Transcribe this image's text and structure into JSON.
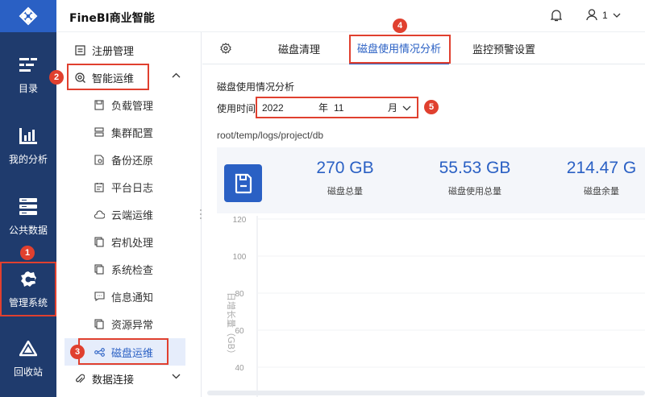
{
  "app": {
    "title": "FineBI商业智能"
  },
  "header": {
    "user_label": "1"
  },
  "rail": {
    "items": [
      {
        "label": "目录",
        "icon": "catalog-icon"
      },
      {
        "label": "我的分析",
        "icon": "analysis-icon"
      },
      {
        "label": "公共数据",
        "icon": "database-icon"
      },
      {
        "label": "管理系统",
        "icon": "settings-icon"
      },
      {
        "label": "回收站",
        "icon": "recycle-icon"
      }
    ]
  },
  "menu": {
    "register": "注册管理",
    "smart_ops": "智能运维",
    "sub_items": [
      "负载管理",
      "集群配置",
      "备份还原",
      "平台日志",
      "云端运维",
      "宕机处理",
      "系统检查",
      "信息通知",
      "资源异常",
      "磁盘运维"
    ],
    "data_conn": "数据连接"
  },
  "tabs": [
    "磁盘清理",
    "磁盘使用情况分析",
    "监控预警设置"
  ],
  "panel": {
    "title": "磁盘使用情况分析",
    "time_label": "使用时间",
    "year": "2022",
    "year_unit": "年",
    "month": "11",
    "month_unit": "月",
    "path": "root/temp/logs/project/db"
  },
  "stats": [
    {
      "value": "270 GB",
      "label": "磁盘总量"
    },
    {
      "value": "55.53 GB",
      "label": "磁盘使用总量"
    },
    {
      "value": "214.47 G",
      "label": "磁盘余量"
    }
  ],
  "badges": [
    "1",
    "2",
    "3",
    "4",
    "5"
  ],
  "chart_data": {
    "type": "line",
    "ylabel": "日增长量（GB）",
    "yticks": [
      "120",
      "100",
      "80",
      "60",
      "40"
    ],
    "ylim": [
      40,
      120
    ],
    "grid": true
  },
  "colors": {
    "primary": "#2a60c4",
    "rail": "#1f3b6d",
    "highlight": "#e0402f"
  }
}
